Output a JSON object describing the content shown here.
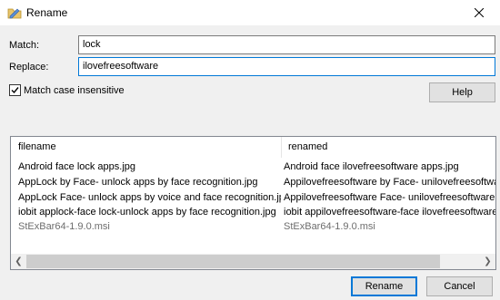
{
  "window": {
    "title": "Rename",
    "icon": "rename-app-icon",
    "close_icon": "close-icon"
  },
  "form": {
    "match_label": "Match:",
    "match_value": "lock",
    "replace_label": "Replace:",
    "replace_value": "ilovefreesoftware",
    "case_insensitive_label": "Match case insensitive",
    "case_insensitive_checked": true,
    "help_button": "Help"
  },
  "list": {
    "columns": [
      "filename",
      "renamed"
    ],
    "rows": [
      {
        "filename": "Android face lock apps.jpg",
        "renamed": "Android face ilovefreesoftware apps.jpg",
        "dim": false
      },
      {
        "filename": "AppLock by Face- unlock apps by face recognition.jpg",
        "renamed": "Appilovefreesoftware by Face- unilovefreesoftware",
        "dim": false
      },
      {
        "filename": "AppLock Face- unlock apps by voice and face recognition.jpg",
        "renamed": "Appilovefreesoftware Face- unilovefreesoftware a",
        "dim": false
      },
      {
        "filename": "iobit applock-face lock-unlock apps by face recognition.jpg",
        "renamed": "iobit appilovefreesoftware-face ilovefreesoftware",
        "dim": false
      },
      {
        "filename": "StExBar64-1.9.0.msi",
        "renamed": "StExBar64-1.9.0.msi",
        "dim": true
      }
    ],
    "scrollbar": {
      "left_icon": "scroll-left-icon",
      "right_icon": "scroll-right-icon"
    }
  },
  "footer": {
    "rename_button": "Rename",
    "cancel_button": "Cancel"
  },
  "colors": {
    "accent": "#0078d7",
    "dim_text": "#6d6d6d"
  }
}
